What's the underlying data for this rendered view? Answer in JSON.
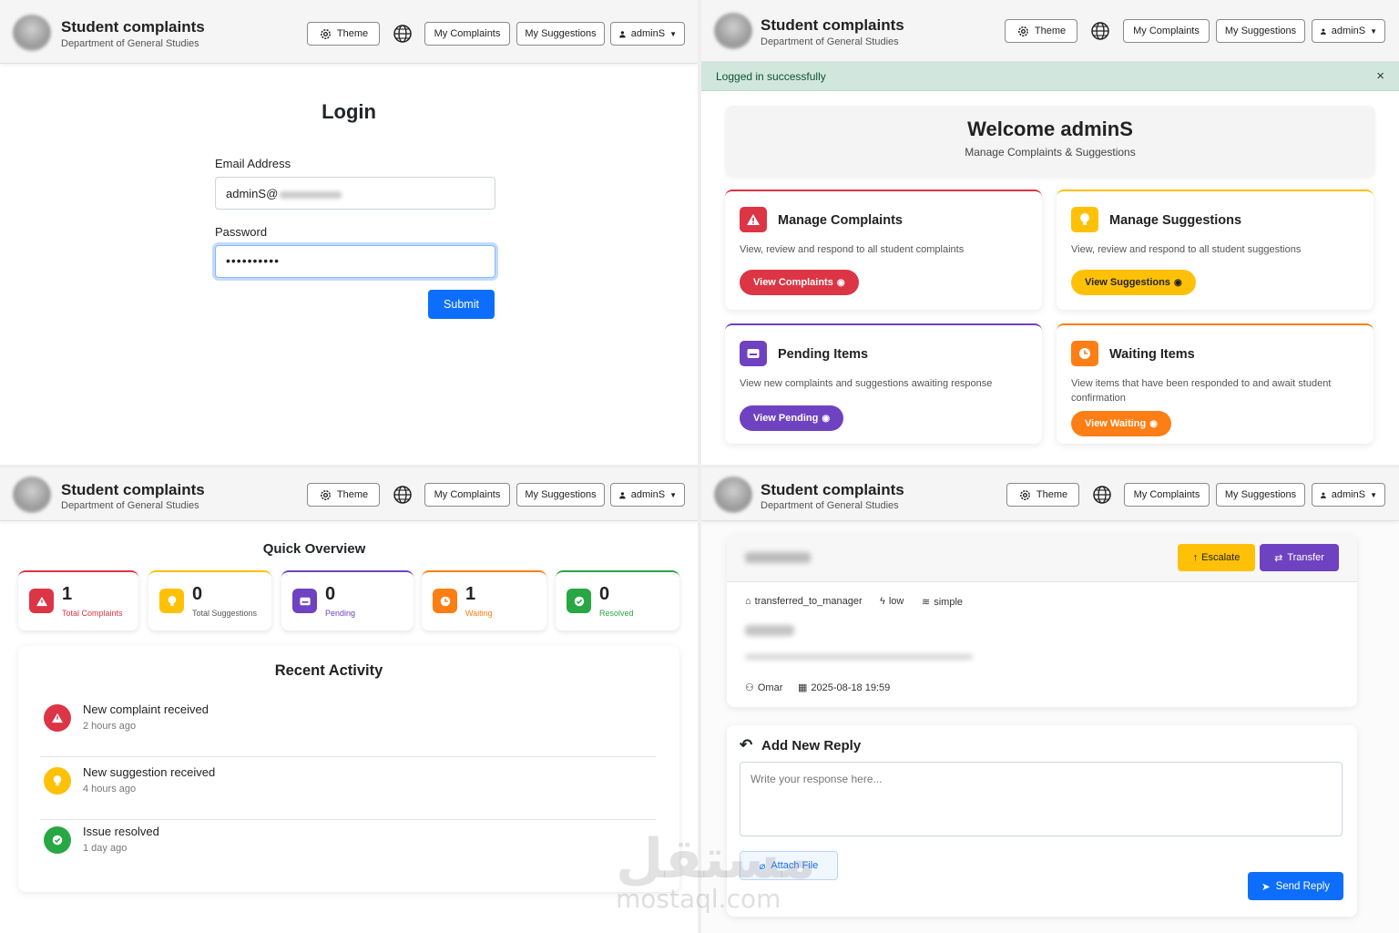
{
  "header": {
    "title": "Student complaints",
    "subtitle": "Department of General Studies",
    "theme_label": "Theme",
    "my_complaints_label": "My Complaints",
    "my_suggestions_label": "My Suggestions",
    "user_label": "adminS"
  },
  "login": {
    "title": "Login",
    "email_label": "Email Address",
    "email_value": "adminS@",
    "password_label": "Password",
    "password_value": "••••••••••",
    "submit_label": "Submit"
  },
  "dashboard": {
    "alert": "Logged in successfully",
    "alert_close": "×",
    "welcome_title": "Welcome adminS",
    "welcome_subtitle": "Manage Complaints & Suggestions",
    "cards": [
      {
        "title": "Manage Complaints",
        "desc": "View, review and respond to all student complaints",
        "button": "View Complaints",
        "color": "#dc3545"
      },
      {
        "title": "Manage Suggestions",
        "desc": "View, review and respond to all student suggestions",
        "button": "View Suggestions",
        "color": "#ffc107"
      },
      {
        "title": "Pending Items",
        "desc": "View new complaints and suggestions awaiting response",
        "button": "View Pending",
        "color": "#6f42c1"
      },
      {
        "title": "Waiting Items",
        "desc": "View items that have been responded to and await student confirmation",
        "button": "View Waiting",
        "color": "#fd7e14"
      }
    ]
  },
  "overview": {
    "title": "Quick Overview",
    "stats": [
      {
        "value": "1",
        "label": "Total Complaints",
        "color": "#dc3545"
      },
      {
        "value": "0",
        "label": "Total Suggestions",
        "color": "#ffc107"
      },
      {
        "value": "0",
        "label": "Pending",
        "color": "#6f42c1"
      },
      {
        "value": "1",
        "label": "Waiting",
        "color": "#fd7e14"
      },
      {
        "value": "0",
        "label": "Resolved",
        "color": "#28a745"
      }
    ],
    "recent_title": "Recent Activity",
    "activities": [
      {
        "title": "New complaint received",
        "time": "2 hours ago"
      },
      {
        "title": "New suggestion received",
        "time": "4 hours ago"
      },
      {
        "title": "Issue resolved",
        "time": "1 day ago"
      }
    ]
  },
  "detail": {
    "escalate_label": "Escalate",
    "transfer_label": "Transfer",
    "status": "transferred_to_manager",
    "priority": "low",
    "type": "simple",
    "author": "Omar",
    "date": "2025-08-18 19:59",
    "reply_title": "Add New Reply",
    "reply_placeholder": "Write your response here...",
    "attach_label": "Attach File",
    "send_label": "Send Reply"
  },
  "watermark": {
    "arabic": "مستقل",
    "latin": "mostaql.com"
  }
}
